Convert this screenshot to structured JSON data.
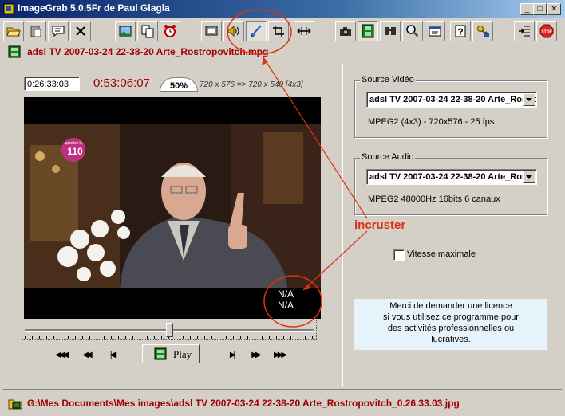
{
  "window": {
    "title": "ImageGrab 5.0.5Fr de Paul Glagla",
    "minimize": "_",
    "maximize": "□",
    "close": "✕"
  },
  "toolbar": {
    "icons": [
      "folder-open-icon",
      "paste-icon",
      "comment-icon",
      "cross-icon",
      "image-icon",
      "copy-icon",
      "alarm-clock-icon",
      "screen-icon",
      "speaker-icon",
      "brush-icon",
      "crop-icon",
      "stretch-icon",
      "camera-icon",
      "filmstrip-icon",
      "binoculars-icon",
      "magnify-icon",
      "settings-icon",
      "help-icon",
      "key-icon",
      "exit-list-icon",
      "stop-icon"
    ],
    "stop_label": "STOP"
  },
  "file": {
    "name": "adsl TV 2007-03-24 22-38-20 Arte_Rostropovitch.mpg"
  },
  "player": {
    "current_time": "0:26:33:03",
    "duration": "0:53:06:07",
    "zoom": "50%",
    "dimensions": "720 x 576  =>  720 x 540 [4x3]",
    "overlay_line1": "N/A",
    "overlay_line2": "N/A",
    "position": 0.5,
    "play_label": "Play",
    "video_badge": "110",
    "video_badge_top": "appelez le"
  },
  "source_video": {
    "legend": "Source Vidéo",
    "selected": "adsl TV 2007-03-24 22-38-20 Arte_Rostropovitch.mpg",
    "info": "MPEG2 (4x3) - 720x576 - 25 fps"
  },
  "source_audio": {
    "legend": "Source Audio",
    "selected": "adsl TV 2007-03-24 22-38-20 Arte_Rostropovitch.mpg",
    "info": "MPEG2 48000Hz 16bits  6 canaux"
  },
  "options": {
    "max_speed_label": "Vitesse maximale",
    "max_speed_checked": false
  },
  "license": {
    "text1": "Merci de demander une licence",
    "text2": "si vous utilisez ce programme pour",
    "text3": "des activités professionnelles ou",
    "text4": "lucratives."
  },
  "status": {
    "output_path": "G:\\Mes Documents\\Mes images\\adsl TV 2007-03-24 22-38-20 Arte_Rostropovitch_0.26.33.03.jpg"
  },
  "annotation": {
    "label": "incruster",
    "color": "#e03010"
  }
}
